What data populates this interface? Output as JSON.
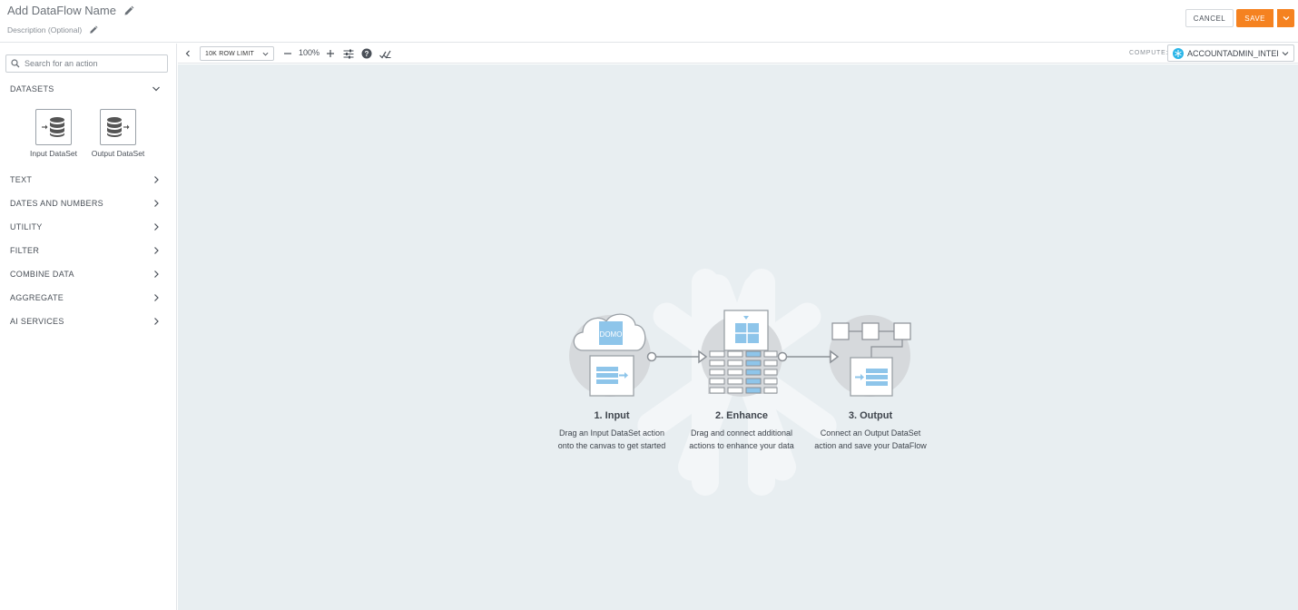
{
  "header": {
    "title": "Add DataFlow Name",
    "description": "Description (Optional)",
    "cancel_label": "CANCEL",
    "save_label": "SAVE"
  },
  "sidebar": {
    "search_placeholder": "Search for an action",
    "datasets_label": "DATASETS",
    "tiles": [
      {
        "label": "Input DataSet",
        "icon": "input-dataset-icon"
      },
      {
        "label": "Output DataSet",
        "icon": "output-dataset-icon"
      }
    ],
    "sections": [
      {
        "label": "TEXT"
      },
      {
        "label": "DATES AND NUMBERS"
      },
      {
        "label": "UTILITY"
      },
      {
        "label": "FILTER"
      },
      {
        "label": "COMBINE DATA"
      },
      {
        "label": "AGGREGATE"
      },
      {
        "label": "AI SERVICES"
      }
    ]
  },
  "toolbar": {
    "row_limit": "10K ROW LIMIT",
    "zoom": "100%",
    "compute_label": "COMPUTE:",
    "compute_value": "ACCOUNTADMIN_INTERNAL"
  },
  "canvas": {
    "logo_text": "DOMO",
    "steps": [
      {
        "title": "1. Input",
        "line1": "Drag an Input DataSet action",
        "line2": "onto the canvas to get started"
      },
      {
        "title": "2. Enhance",
        "line1": "Drag and connect additional",
        "line2": "actions to enhance your data"
      },
      {
        "title": "3. Output",
        "line1": "Connect an Output DataSet",
        "line2": "action and save your DataFlow"
      }
    ]
  },
  "colors": {
    "accent": "#f58220",
    "canvas_bg": "#e8eef1",
    "illus_blue": "#8ec5ea"
  }
}
